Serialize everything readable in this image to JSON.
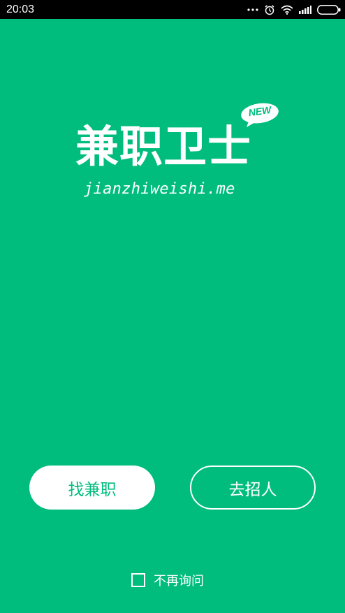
{
  "status_bar": {
    "time": "20:03",
    "icons": [
      "more-dots-icon",
      "alarm-clock-icon",
      "wifi-icon",
      "signal-icon",
      "battery-icon"
    ]
  },
  "logo": {
    "title": "兼职卫士",
    "badge": "NEW",
    "domain": "jianzhiweishi.me"
  },
  "buttons": {
    "find_job": "找兼职",
    "recruit": "去招人"
  },
  "dont_ask": {
    "label": "不再询问",
    "checked": false
  },
  "colors": {
    "background": "#00bd7e",
    "status_bar": "#000000",
    "foreground": "#ffffff"
  }
}
